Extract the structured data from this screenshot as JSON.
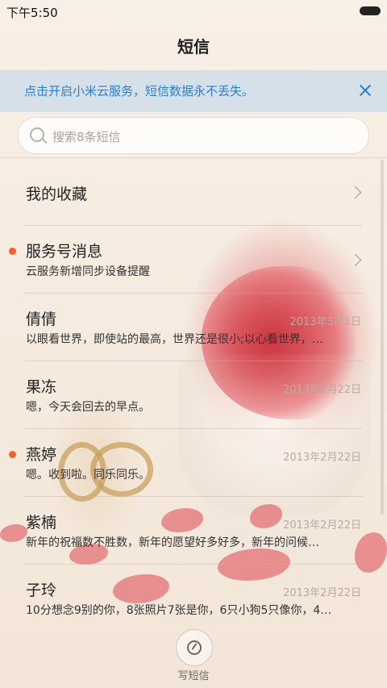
{
  "status_bar": {
    "time": "下午5:50"
  },
  "header": {
    "title": "短信"
  },
  "banner": {
    "text": "点击开启小米云服务，短信数据永不丢失。"
  },
  "search": {
    "placeholder": "搜索8条短信"
  },
  "list": {
    "favorites": {
      "label": "我的收藏"
    },
    "service": {
      "name": "服务号消息",
      "preview": "云服务新增同步设备提醒",
      "unread": true
    },
    "threads": [
      {
        "name": "倩倩",
        "preview": "以眼看世界，即使站的最高，世界还是很小;以心看世界，…",
        "date": "2013年3月1日",
        "unread": false
      },
      {
        "name": "果冻",
        "preview": "嗯，今天会回去的早点。",
        "date": "2013年2月22日",
        "unread": false
      },
      {
        "name": "燕婷",
        "preview": "嗯。收到啦。同乐同乐。",
        "date": "2013年2月22日",
        "unread": true
      },
      {
        "name": "紫楠",
        "preview": "新年的祝福数不胜数，新年的愿望好多好多，新年的问候…",
        "date": "2013年2月22日",
        "unread": false
      },
      {
        "name": "子玲",
        "preview": "10分想念9别的你，8张照片7张是你，6只小狗5只像你，4…",
        "date": "2013年2月22日",
        "unread": false
      }
    ]
  },
  "compose": {
    "label": "写短信",
    "icon": "compose-icon"
  },
  "colors": {
    "accent": "#2b7fd4",
    "unread_dot": "#f5612a"
  }
}
